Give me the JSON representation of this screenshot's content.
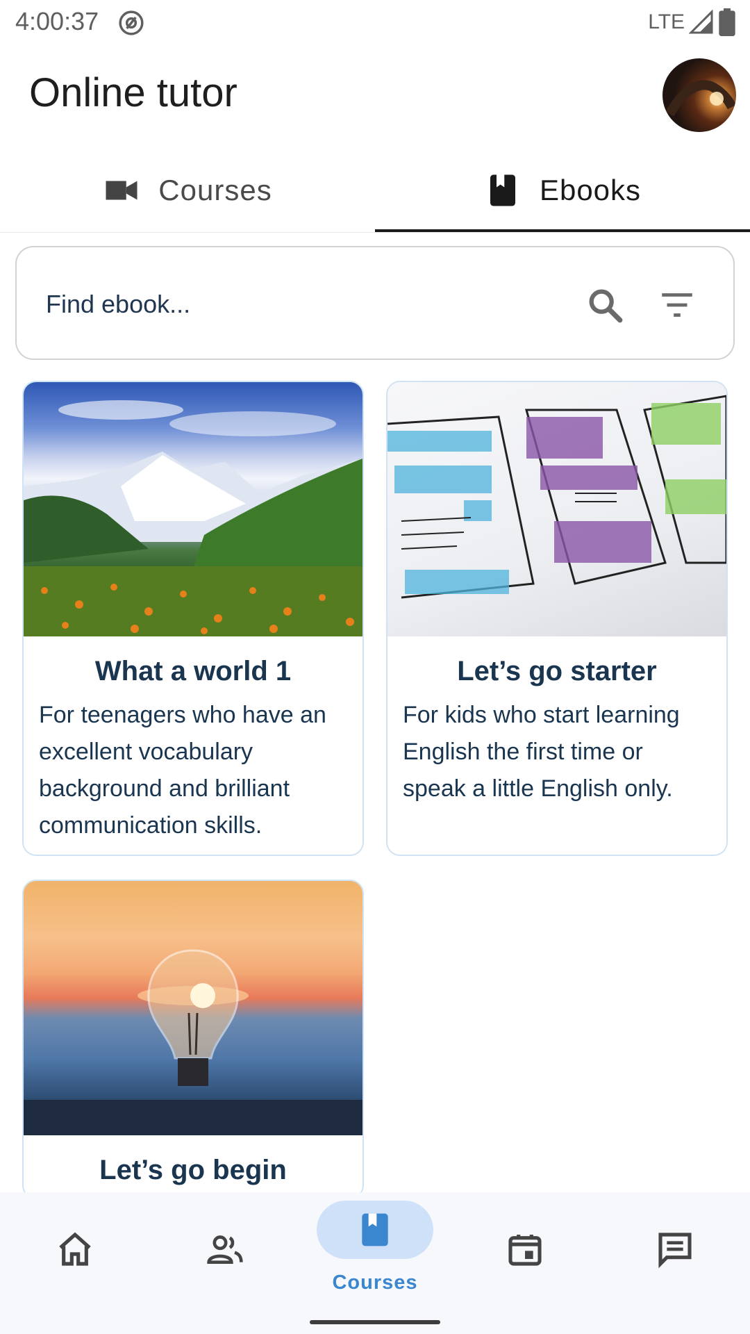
{
  "status_bar": {
    "time": "4:00:37",
    "network": "LTE"
  },
  "header": {
    "title": "Online tutor"
  },
  "tabs": [
    {
      "label": "Courses",
      "icon": "video-camera-icon",
      "selected": false
    },
    {
      "label": "Ebooks",
      "icon": "book-icon",
      "selected": true
    }
  ],
  "search": {
    "placeholder": "Find ebook...",
    "value": ""
  },
  "ebooks": [
    {
      "title": "What a world 1",
      "description": "For teenagers who have an excellent vocabulary background and brilliant communication skills."
    },
    {
      "title": "Let’s go starter",
      "description": "For kids who start learning English the first time or speak a little English only."
    },
    {
      "title": "Let’s go begin",
      "description": ""
    }
  ],
  "bottom_nav": {
    "items": [
      {
        "name": "home",
        "icon": "home-icon",
        "label": ""
      },
      {
        "name": "people",
        "icon": "people-icon",
        "label": ""
      },
      {
        "name": "courses",
        "icon": "book-icon",
        "label": "Courses",
        "selected": true
      },
      {
        "name": "calendar",
        "icon": "calendar-icon",
        "label": ""
      },
      {
        "name": "messages",
        "icon": "message-icon",
        "label": ""
      }
    ]
  },
  "colors": {
    "accent": "#3a86cf",
    "title_text": "#1a3550",
    "nav_pill": "#cfe1f8",
    "card_border": "#cfe3f4"
  }
}
